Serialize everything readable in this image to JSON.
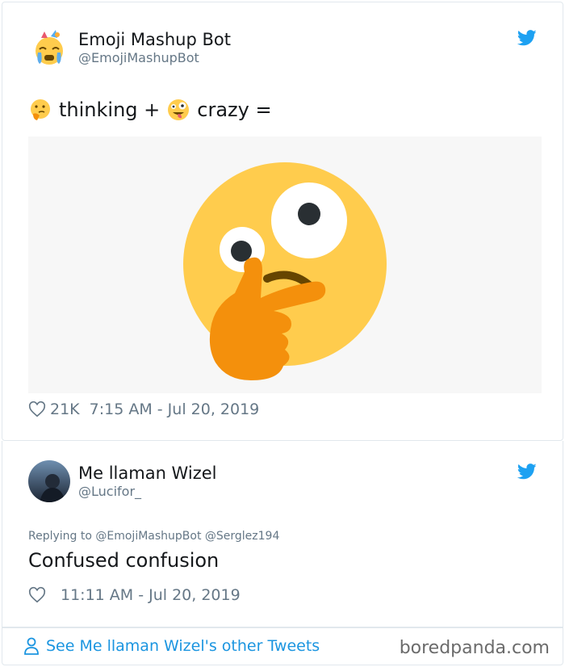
{
  "tweet": {
    "author_name": "Emoji Mashup Bot",
    "author_handle": "@EmojiMashupBot",
    "text_part1": "thinking +",
    "text_part2": "crazy =",
    "likes": "21K",
    "timestamp": "7:15 AM - Jul 20, 2019"
  },
  "reply": {
    "author_name": "Me llaman Wizel",
    "author_handle": "@Lucifor_",
    "replying_to": "Replying to @EmojiMashupBot @Serglez194",
    "text": "Confused confusion",
    "timestamp": "11:11 AM - Jul 20, 2019"
  },
  "footer": {
    "see_more": "See Me llaman Wizel's other Tweets",
    "watermark": "boredpanda.com"
  },
  "colors": {
    "twitter_blue": "#1da1f2",
    "link_blue": "#1b95e0",
    "muted": "#657786",
    "emoji_yellow": "#ffcc4d",
    "hand_orange": "#f4900c"
  },
  "icons": {
    "bird": "twitter-bird-icon",
    "heart": "heart-outline-icon",
    "user": "user-outline-icon"
  }
}
